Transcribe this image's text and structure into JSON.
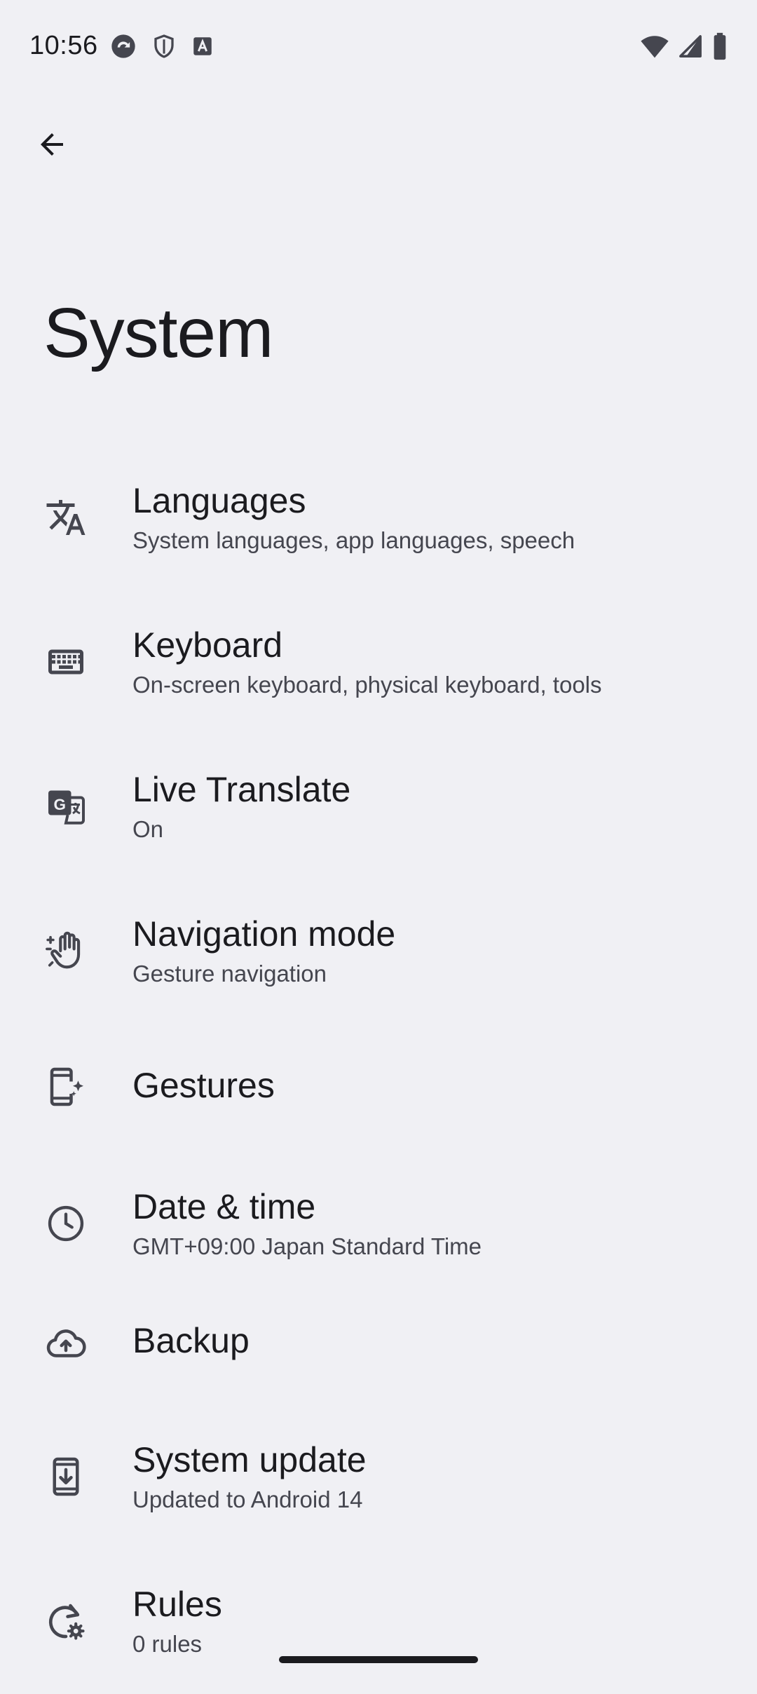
{
  "status_bar": {
    "time": "10:56",
    "left_icons": [
      "sync-icon",
      "shield-icon",
      "font-icon"
    ],
    "right_icons": [
      "wifi-icon",
      "cellular-signal-icon",
      "battery-icon"
    ]
  },
  "header": {
    "back_icon": "arrow-back-icon",
    "title": "System"
  },
  "items": [
    {
      "id": "languages",
      "icon": "translate-icon",
      "title": "Languages",
      "summary": "System languages, app languages, speech"
    },
    {
      "id": "keyboard",
      "icon": "keyboard-icon",
      "title": "Keyboard",
      "summary": "On-screen keyboard, physical keyboard, tools"
    },
    {
      "id": "live-translate",
      "icon": "live-translate-icon",
      "title": "Live Translate",
      "summary": "On"
    },
    {
      "id": "navigation-mode",
      "icon": "gesture-hand-icon",
      "title": "Navigation mode",
      "summary": "Gesture navigation"
    },
    {
      "id": "gestures",
      "icon": "phone-sparkle-icon",
      "title": "Gestures",
      "summary": ""
    },
    {
      "id": "date-time",
      "icon": "clock-icon",
      "title": "Date & time",
      "summary": "GMT+09:00 Japan Standard Time"
    },
    {
      "id": "backup",
      "icon": "cloud-upload-icon",
      "title": "Backup",
      "summary": ""
    },
    {
      "id": "system-update",
      "icon": "system-update-icon",
      "title": "System update",
      "summary": "Updated to Android 14"
    },
    {
      "id": "rules",
      "icon": "rules-icon",
      "title": "Rules",
      "summary": "0 rules"
    }
  ],
  "colors": {
    "background": "#f0f0f4",
    "text_primary": "#1b1b1f",
    "text_secondary": "#45464f",
    "icon": "#45464f"
  }
}
